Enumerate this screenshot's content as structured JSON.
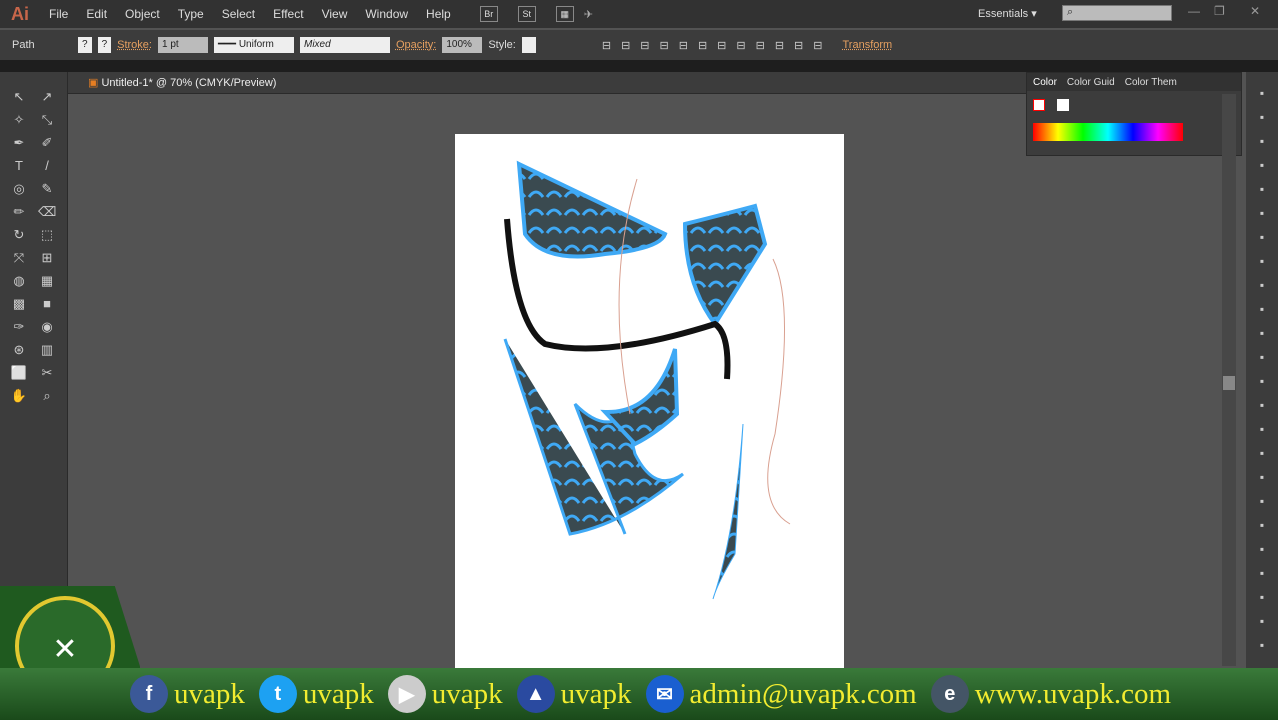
{
  "app": {
    "logo": "Ai",
    "menus": [
      "File",
      "Edit",
      "Object",
      "Type",
      "Select",
      "Effect",
      "View",
      "Window",
      "Help"
    ],
    "bridge": "Br",
    "stock": "St",
    "workspace": "Essentials",
    "search_placeholder": ""
  },
  "control": {
    "selection": "Path",
    "fill": "?",
    "stroke_box": "?",
    "stroke_label": "Stroke:",
    "stroke_weight": "1 pt",
    "profile": "Uniform",
    "brush": "Mixed",
    "opacity_label": "Opacity:",
    "opacity": "100%",
    "style_label": "Style:",
    "transform": "Transform"
  },
  "document": {
    "tab_title": "Untitled-1* @ 70% (CMYK/Preview)"
  },
  "color_panel": {
    "tabs": [
      "Color",
      "Color Guid",
      "Color Them"
    ]
  },
  "banner": {
    "items": [
      {
        "icon": "facebook-icon",
        "text": "uvapk",
        "color": "#3b5998",
        "glyph": "f"
      },
      {
        "icon": "twitter-icon",
        "text": "uvapk",
        "color": "#1da1f2",
        "glyph": "t"
      },
      {
        "icon": "youtube-icon",
        "text": "uvapk",
        "color": "#ccc",
        "glyph": "▶"
      },
      {
        "icon": "app-icon",
        "text": "uvapk",
        "color": "#2a4aa0",
        "glyph": "▲"
      },
      {
        "icon": "mail-icon",
        "text": "admin@uvapk.com",
        "color": "#1a5fd0",
        "glyph": "✉"
      },
      {
        "icon": "web-icon",
        "text": "www.uvapk.com",
        "color": "#456",
        "glyph": "e"
      }
    ]
  },
  "colors": {
    "accent": "#e6a060",
    "artwork_blue": "#3fa9f5",
    "artwork_dark": "#3a4a50"
  }
}
